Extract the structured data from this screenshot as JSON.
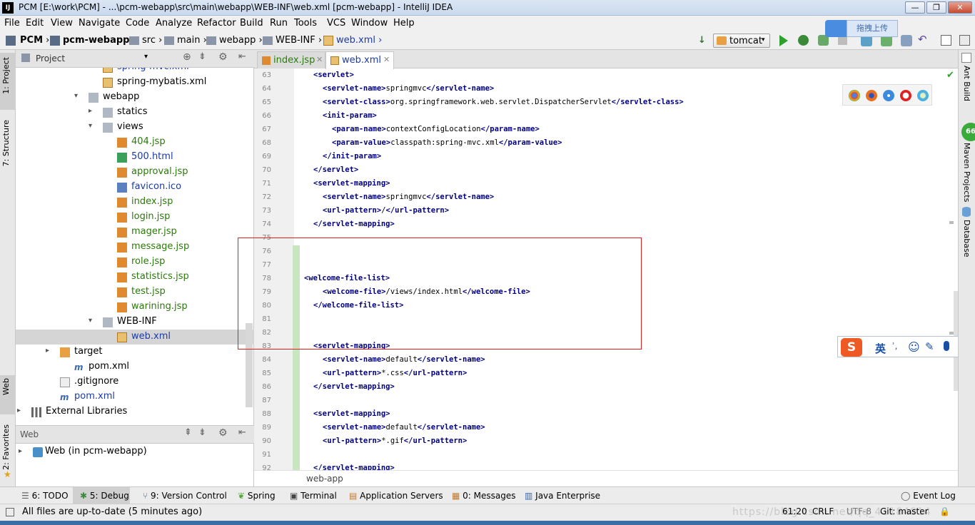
{
  "window": {
    "app_icon": "IJ",
    "title": "PCM [E:\\work\\PCM] - ...\\pcm-webapp\\src\\main\\webapp\\WEB-INF\\web.xml [pcm-webapp] - IntelliJ IDEA",
    "min": "—",
    "max": "❐",
    "close": "✕"
  },
  "menu": [
    "File",
    "Edit",
    "View",
    "Navigate",
    "Code",
    "Analyze",
    "Refactor",
    "Build",
    "Run",
    "Tools",
    "VCS",
    "Window",
    "Help"
  ],
  "breadcrumb": [
    "PCM",
    "pcm-webapp",
    "src",
    "main",
    "webapp",
    "WEB-INF",
    "web.xml"
  ],
  "run_config": "tomcat",
  "upload_label": "拖拽上传",
  "project_panel": {
    "title": "Project",
    "tree": [
      {
        "label": "spring-mvc.xml",
        "color": "blue",
        "indent": 5,
        "icon": "xml"
      },
      {
        "label": "spring-mybatis.xml",
        "color": "normal",
        "indent": 5,
        "icon": "xml"
      },
      {
        "label": "webapp",
        "color": "normal",
        "indent": 4,
        "icon": "folder",
        "arrow": "▾"
      },
      {
        "label": "statics",
        "color": "normal",
        "indent": 5,
        "icon": "folder",
        "arrow": "▸"
      },
      {
        "label": "views",
        "color": "normal",
        "indent": 5,
        "icon": "folder",
        "arrow": "▾"
      },
      {
        "label": "404.jsp",
        "color": "green",
        "indent": 6,
        "icon": "jsp"
      },
      {
        "label": "500.html",
        "color": "blue",
        "indent": 6,
        "icon": "html"
      },
      {
        "label": "approval.jsp",
        "color": "green",
        "indent": 6,
        "icon": "jsp"
      },
      {
        "label": "favicon.ico",
        "color": "blue",
        "indent": 6,
        "icon": "ico"
      },
      {
        "label": "index.jsp",
        "color": "green",
        "indent": 6,
        "icon": "jsp"
      },
      {
        "label": "login.jsp",
        "color": "green",
        "indent": 6,
        "icon": "jsp"
      },
      {
        "label": "mager.jsp",
        "color": "green",
        "indent": 6,
        "icon": "jsp"
      },
      {
        "label": "message.jsp",
        "color": "green",
        "indent": 6,
        "icon": "jsp"
      },
      {
        "label": "role.jsp",
        "color": "green",
        "indent": 6,
        "icon": "jsp"
      },
      {
        "label": "statistics.jsp",
        "color": "green",
        "indent": 6,
        "icon": "jsp"
      },
      {
        "label": "test.jsp",
        "color": "green",
        "indent": 6,
        "icon": "jsp"
      },
      {
        "label": "warining.jsp",
        "color": "green",
        "indent": 6,
        "icon": "jsp"
      },
      {
        "label": "WEB-INF",
        "color": "normal",
        "indent": 5,
        "icon": "folder",
        "arrow": "▾"
      },
      {
        "label": "web.xml",
        "color": "blue",
        "indent": 6,
        "icon": "xml",
        "selected": true
      },
      {
        "label": "target",
        "color": "normal",
        "indent": 2,
        "icon": "folder-orange",
        "arrow": "▸"
      },
      {
        "label": "pom.xml",
        "color": "normal",
        "indent": 3,
        "icon": "maven"
      },
      {
        "label": ".gitignore",
        "color": "normal",
        "indent": 2,
        "icon": "file"
      },
      {
        "label": "pom.xml",
        "color": "blue",
        "indent": 2,
        "icon": "maven"
      },
      {
        "label": "External Libraries",
        "color": "normal",
        "indent": 0,
        "icon": "lib",
        "arrow": "▸"
      }
    ]
  },
  "web_panel": {
    "title": "Web",
    "item": "Web (in pcm-webapp)"
  },
  "left_tabs": [
    "1: Project",
    "7: Structure",
    "Web",
    "2: Favorites"
  ],
  "right_tabs": [
    "Ant Build",
    "Maven Projects",
    "Database"
  ],
  "editor": {
    "tabs": [
      {
        "label": "index.jsp",
        "active": false
      },
      {
        "label": "web.xml",
        "active": true
      }
    ],
    "lines": [
      {
        "n": "63",
        "indent": 1,
        "parts": [
          [
            "t",
            "<servlet>"
          ]
        ]
      },
      {
        "n": "64",
        "indent": 2,
        "parts": [
          [
            "t",
            "<servlet-name>"
          ],
          [
            "x",
            "springmvc"
          ],
          [
            "t",
            "</servlet-name>"
          ]
        ]
      },
      {
        "n": "65",
        "indent": 2,
        "parts": [
          [
            "t",
            "<servlet-class>"
          ],
          [
            "x",
            "org.springframework.web.servlet.DispatcherServlet"
          ],
          [
            "t",
            "</servlet-class>"
          ]
        ]
      },
      {
        "n": "66",
        "indent": 2,
        "parts": [
          [
            "t",
            "<init-param>"
          ]
        ]
      },
      {
        "n": "67",
        "indent": 3,
        "parts": [
          [
            "t",
            "<param-name>"
          ],
          [
            "x",
            "contextConfigLocation"
          ],
          [
            "t",
            "</param-name>"
          ]
        ]
      },
      {
        "n": "68",
        "indent": 3,
        "parts": [
          [
            "t",
            "<param-value>"
          ],
          [
            "x",
            "classpath:spring-mvc.xml"
          ],
          [
            "t",
            "</param-value>"
          ]
        ]
      },
      {
        "n": "69",
        "indent": 2,
        "parts": [
          [
            "t",
            "</init-param>"
          ]
        ]
      },
      {
        "n": "70",
        "indent": 1,
        "parts": [
          [
            "t",
            "</servlet>"
          ]
        ]
      },
      {
        "n": "71",
        "indent": 1,
        "parts": [
          [
            "t",
            "<servlet-mapping>"
          ]
        ]
      },
      {
        "n": "72",
        "indent": 2,
        "parts": [
          [
            "t",
            "<servlet-name>"
          ],
          [
            "x",
            "springmvc"
          ],
          [
            "t",
            "</servlet-name>"
          ]
        ]
      },
      {
        "n": "73",
        "indent": 2,
        "parts": [
          [
            "t",
            "<url-pattern>"
          ],
          [
            "x",
            "/"
          ],
          [
            "t",
            "</url-pattern>"
          ]
        ]
      },
      {
        "n": "74",
        "indent": 1,
        "parts": [
          [
            "t",
            "</servlet-mapping>"
          ]
        ]
      },
      {
        "n": "75",
        "indent": 0,
        "parts": []
      },
      {
        "n": "76",
        "indent": 0,
        "parts": []
      },
      {
        "n": "77",
        "indent": 0,
        "parts": []
      },
      {
        "n": "78",
        "indent": 0,
        "parts": [
          [
            "t",
            "<welcome-file-list>"
          ]
        ]
      },
      {
        "n": "79",
        "indent": 2,
        "parts": [
          [
            "t",
            "<welcome-file>"
          ],
          [
            "x",
            "/views/index.html"
          ],
          [
            "t",
            "</welcome-file>"
          ]
        ]
      },
      {
        "n": "80",
        "indent": 1,
        "parts": [
          [
            "t",
            "</welcome-file-list>"
          ]
        ]
      },
      {
        "n": "81",
        "indent": 0,
        "parts": []
      },
      {
        "n": "82",
        "indent": 0,
        "parts": []
      },
      {
        "n": "83",
        "indent": 1,
        "parts": [
          [
            "t",
            "<servlet-mapping>"
          ]
        ]
      },
      {
        "n": "84",
        "indent": 2,
        "parts": [
          [
            "t",
            "<servlet-name>"
          ],
          [
            "x",
            "default"
          ],
          [
            "t",
            "</servlet-name>"
          ]
        ]
      },
      {
        "n": "85",
        "indent": 2,
        "parts": [
          [
            "t",
            "<url-pattern>"
          ],
          [
            "x",
            "*.css"
          ],
          [
            "t",
            "</url-pattern>"
          ]
        ]
      },
      {
        "n": "86",
        "indent": 1,
        "parts": [
          [
            "t",
            "</servlet-mapping>"
          ]
        ]
      },
      {
        "n": "87",
        "indent": 0,
        "parts": []
      },
      {
        "n": "88",
        "indent": 1,
        "parts": [
          [
            "t",
            "<servlet-mapping>"
          ]
        ]
      },
      {
        "n": "89",
        "indent": 2,
        "parts": [
          [
            "t",
            "<servlet-name>"
          ],
          [
            "x",
            "default"
          ],
          [
            "t",
            "</servlet-name>"
          ]
        ]
      },
      {
        "n": "90",
        "indent": 2,
        "parts": [
          [
            "t",
            "<url-pattern>"
          ],
          [
            "x",
            "*.gif"
          ],
          [
            "t",
            "</url-pattern>"
          ]
        ]
      },
      {
        "n": "91",
        "indent": 0,
        "parts": []
      },
      {
        "n": "92",
        "indent": 1,
        "parts": [
          [
            "t",
            "</servlet-mapping>"
          ]
        ]
      }
    ],
    "breadcrumb": "web-app",
    "tag_color": "#000080",
    "highlight_color": "#e02020"
  },
  "ime": {
    "logo": "S",
    "lang": "英",
    "punct": "ʾ,"
  },
  "bottom_tools": [
    {
      "icon": "todo-icon",
      "label": "6: TODO"
    },
    {
      "icon": "debug-icon",
      "label": "5: Debug"
    },
    {
      "icon": "vcs-icon",
      "label": "9: Version Control"
    },
    {
      "icon": "spring-icon",
      "label": "Spring"
    },
    {
      "icon": "terminal-icon",
      "label": "Terminal"
    },
    {
      "icon": "server-icon",
      "label": "Application Servers"
    },
    {
      "icon": "messages-icon",
      "label": "0: Messages"
    },
    {
      "icon": "javaee-icon",
      "label": "Java Enterprise"
    }
  ],
  "event_log": "Event Log",
  "status": {
    "message": "All files are up-to-date (5 minutes ago)",
    "position": "61:20",
    "line_sep": "CRLF",
    "encoding": "UTF-8",
    "git": "Git: master",
    "watermark": "https://blog.csdn.net/qq_41184814"
  },
  "maven_badge": "66"
}
